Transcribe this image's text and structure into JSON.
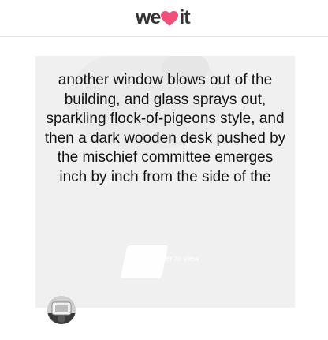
{
  "header": {
    "logo_text_left": "we",
    "logo_text_right": "it",
    "heart_color": "#ef4f78"
  },
  "post": {
    "quote": "another window blows out of the building, and glass sprays out, sparkling flock-of-pigeons style, and then a dark wooden desk pushed by the mischief committee emerges inch by inch from the side of the",
    "reveal_hint": "mouse over to view"
  },
  "icons": {
    "logo_heart": "heart-icon",
    "avatar": "user-avatar"
  }
}
